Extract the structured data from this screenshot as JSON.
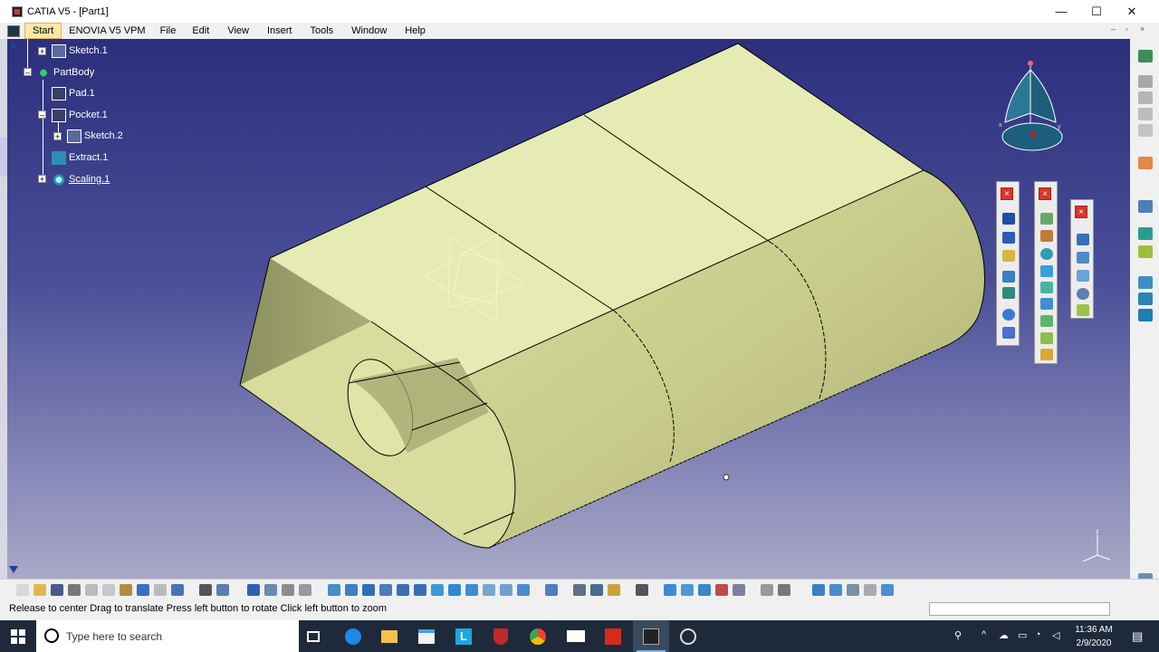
{
  "window": {
    "title": "CATIA V5 - [Part1]",
    "minimize": "—",
    "maximize": "☐",
    "close": "✕"
  },
  "menu": {
    "items": [
      {
        "label": "Start"
      },
      {
        "label": "ENOVIA V5 VPM"
      },
      {
        "label": "File"
      },
      {
        "label": "Edit"
      },
      {
        "label": "View"
      },
      {
        "label": "Insert"
      },
      {
        "label": "Tools"
      },
      {
        "label": "Window"
      },
      {
        "label": "Help"
      }
    ],
    "mdi": {
      "minimize": "–",
      "restore": "▫",
      "close": "×"
    }
  },
  "tree": {
    "nodes": [
      {
        "label": "Sketch.1",
        "icon": "sketch-icon"
      },
      {
        "label": "PartBody",
        "icon": "partbody-gear-icon"
      },
      {
        "label": "Pad.1",
        "icon": "pad-icon"
      },
      {
        "label": "Pocket.1",
        "icon": "pocket-icon"
      },
      {
        "label": "Sketch.2",
        "icon": "sketch-icon"
      },
      {
        "label": "Extract.1",
        "icon": "extract-icon"
      },
      {
        "label": "Scaling.1",
        "icon": "scaling-icon"
      }
    ]
  },
  "palettes": {
    "close_label": "×"
  },
  "compass": {
    "x_label": "x",
    "y_label": "y"
  },
  "axis": {
    "z_label": "z"
  },
  "status": {
    "message": "Release to center  Drag to translate  Press left button to rotate  Click left button to zoom"
  },
  "taskbar": {
    "search_placeholder": "Type here to search",
    "time": "11:36 AM",
    "date": "2/9/2020",
    "apps": [
      "task-view-icon",
      "edge-icon",
      "file-explorer-icon",
      "store-icon",
      "lync-icon",
      "mcafee-icon",
      "chrome-icon",
      "mail-icon",
      "acrobat-icon",
      "catia-icon",
      "settings-icon"
    ]
  },
  "colors": {
    "part_face": "#e6ebb4",
    "part_shadow": "#9b9f72",
    "viewport_top": "#2c2f7c",
    "viewport_bottom": "#a8a8c6",
    "start_highlight": "#fbe7a6"
  }
}
